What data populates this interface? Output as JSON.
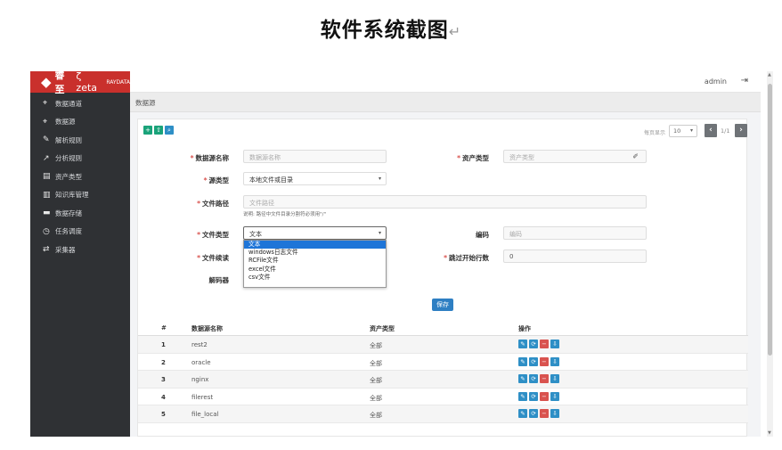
{
  "doc_title": "软件系统截图",
  "doc_title_mark": "↵",
  "sidebar": {
    "logo": {
      "mark": "◆",
      "brand": "睿至",
      "zeta": "ζ zeta",
      "sub": "RAYDATA"
    },
    "items": [
      {
        "icon": "pin-icon",
        "glyph": "⌖",
        "label": "数据通道"
      },
      {
        "icon": "pin-icon",
        "glyph": "⌖",
        "label": "数据源"
      },
      {
        "icon": "wrench-icon",
        "glyph": "✎",
        "label": "解析规则"
      },
      {
        "icon": "wand-icon",
        "glyph": "↗",
        "label": "分析规则"
      },
      {
        "icon": "asset-icon",
        "glyph": "▤",
        "label": "资产类型"
      },
      {
        "icon": "kb-icon",
        "glyph": "▥",
        "label": "知识库管理"
      },
      {
        "icon": "storage-icon",
        "glyph": "▬",
        "label": "数据存储"
      },
      {
        "icon": "clock-icon",
        "glyph": "◷",
        "label": "任务调度"
      },
      {
        "icon": "exchange-icon",
        "glyph": "⇄",
        "label": "采集器"
      }
    ]
  },
  "topbar": {
    "user": "admin",
    "logout_glyph": "⇥"
  },
  "breadcrumb": "数据源",
  "toolbar": {
    "add_glyph": "+",
    "upload_glyph": "⇧",
    "search_glyph": "⌕"
  },
  "pager": {
    "label": "每页显示",
    "page_size": "10",
    "info": "1/1",
    "prev": "‹",
    "next": "›"
  },
  "form": {
    "name_label": "数据源名称",
    "name_placeholder": "数据源名称",
    "asset_label": "资产类型",
    "asset_placeholder": "资产类型",
    "source_type_label": "源类型",
    "source_type_value": "本地文件或目录",
    "path_label": "文件路径",
    "path_placeholder": "文件路径",
    "path_note": "说明: 路径中文件目录分割符必须用\"/\"",
    "file_type_label": "文件类型",
    "file_type_value": "文本",
    "encoding_label": "编码",
    "encoding_placeholder": "编码",
    "read_label": "文件续读",
    "skip_label": "跳过开始行数",
    "skip_value": "0",
    "decoder_label": "解码器",
    "dropdown_options": [
      "文本",
      "windows日志文件",
      "RCFile文件",
      "excel文件",
      "csv文件"
    ],
    "save_label": "保存"
  },
  "table": {
    "headers": [
      "#",
      "数据源名称",
      "资产类型",
      "操作"
    ],
    "rows": [
      {
        "num": "1",
        "name": "rest2",
        "type": "全部"
      },
      {
        "num": "2",
        "name": "oracle",
        "type": "全部"
      },
      {
        "num": "3",
        "name": "nginx",
        "type": "全部"
      },
      {
        "num": "4",
        "name": "filerest",
        "type": "全部"
      },
      {
        "num": "5",
        "name": "file_local",
        "type": "全部"
      }
    ],
    "op_glyphs": [
      "✎",
      "⟳",
      "−",
      "⇩"
    ]
  }
}
